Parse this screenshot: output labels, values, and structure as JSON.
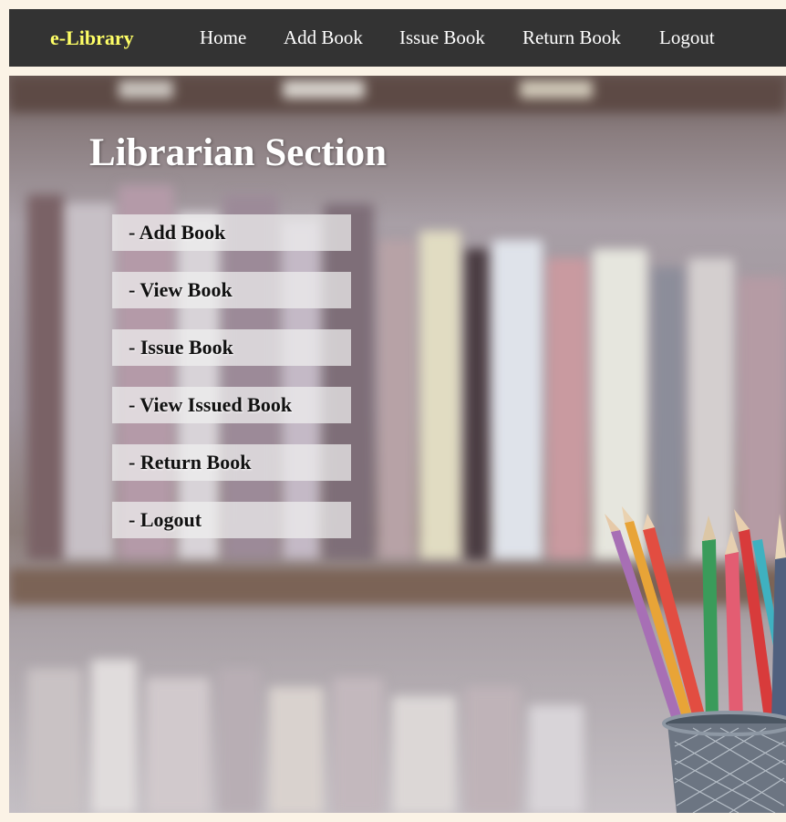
{
  "navbar": {
    "brand": "e-Library",
    "links": [
      "Home",
      "Add Book",
      "Issue Book",
      "Return Book",
      "Logout"
    ]
  },
  "main": {
    "title": "Librarian Section",
    "menu": [
      "- Add Book",
      "- View Book",
      "- Issue Book",
      "- View Issued Book",
      "- Return Book",
      "- Logout"
    ]
  },
  "colors": {
    "navbar_bg": "#333333",
    "brand": "#ffff66",
    "nav_text": "#ffffff",
    "page_bg": "#fbf3e6",
    "menu_bg": "#f0f0f0"
  },
  "icons": {
    "hero_image": "bookshelf-with-pencil-cup"
  }
}
